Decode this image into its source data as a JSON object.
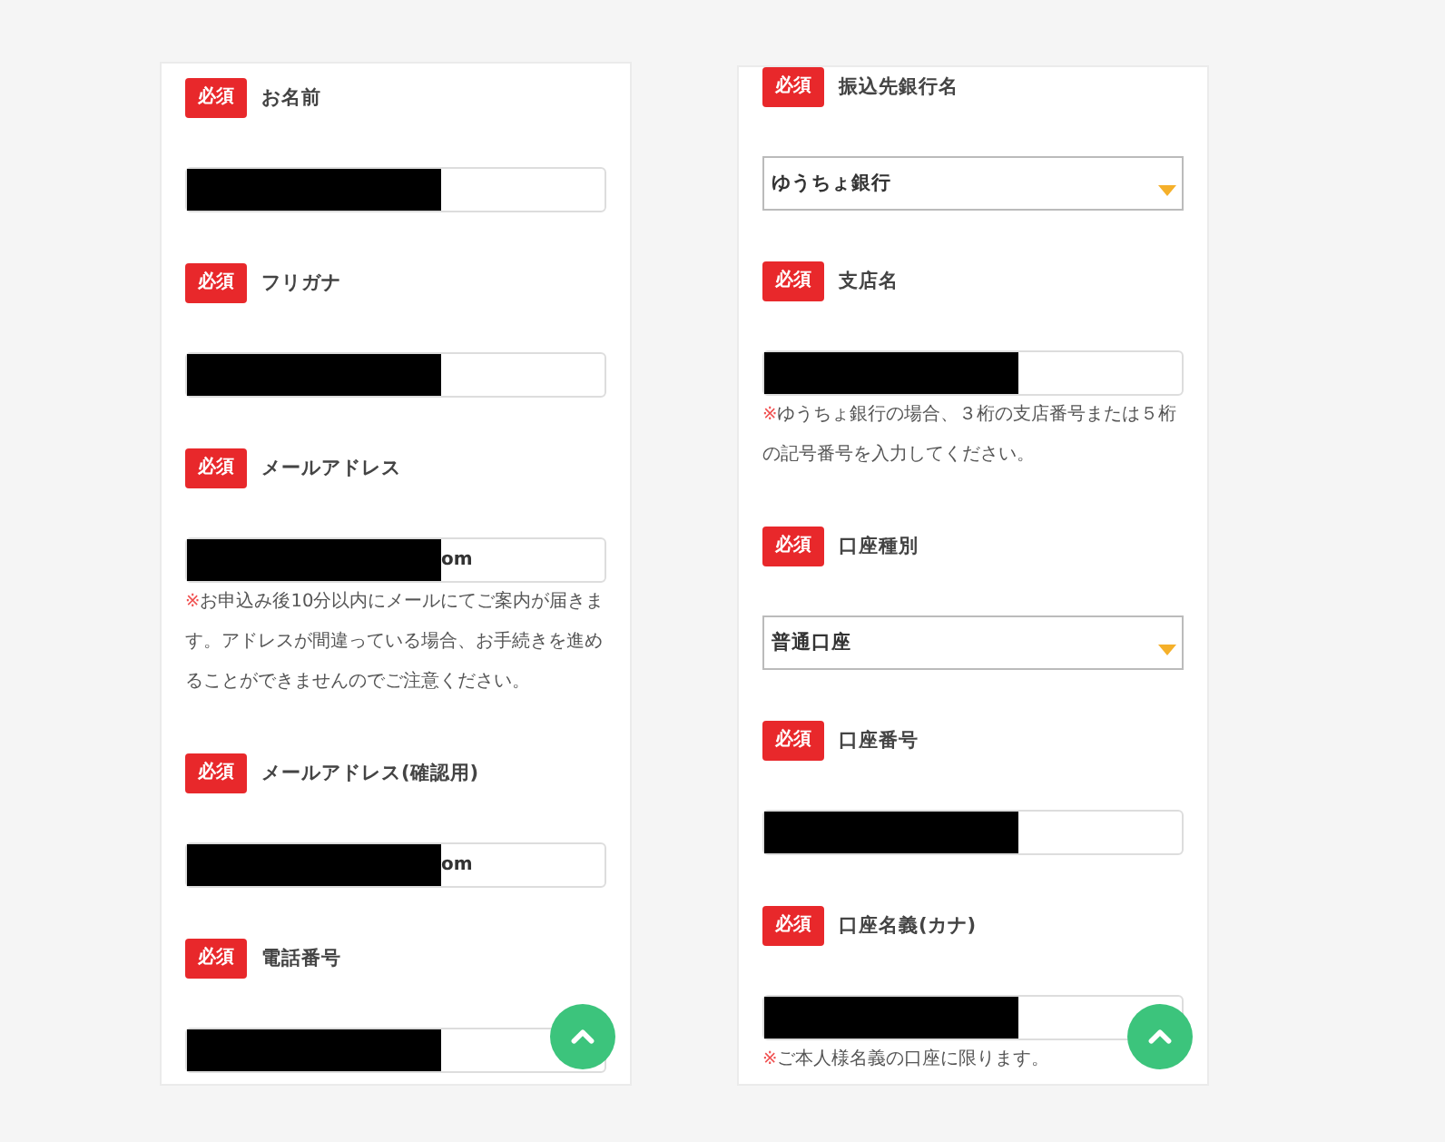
{
  "panels": [
    {
      "fields": [
        {
          "badge": "必須",
          "label": "お名前",
          "kind": "text",
          "redacted": true
        },
        {
          "badge": "必須",
          "label": "フリガナ",
          "kind": "text",
          "redacted": true
        },
        {
          "badge": "必須",
          "label": "メールアドレス",
          "kind": "text",
          "redacted": true,
          "value": "om",
          "note_mark": "※",
          "note": "お申込み後10分以内にメールにてご案内が届きます。アドレスが間違っている場合、お手続きを進めることができませんのでご注意ください。"
        },
        {
          "badge": "必須",
          "label": "メールアドレス(確認用)",
          "kind": "text",
          "redacted": true,
          "value": "om"
        },
        {
          "badge": "必須",
          "label": "電話番号",
          "kind": "text",
          "redacted": true
        }
      ]
    },
    {
      "fields": [
        {
          "badge": "必須",
          "label": "振込先銀行名",
          "kind": "select",
          "value": "ゆうちょ銀行"
        },
        {
          "badge": "必須",
          "label": "支店名",
          "kind": "text",
          "redacted": true,
          "note_mark": "※",
          "note": "ゆうちょ銀行の場合、３桁の支店番号または５桁の記号番号を入力してください。"
        },
        {
          "badge": "必須",
          "label": "口座種別",
          "kind": "select",
          "value": "普通口座"
        },
        {
          "badge": "必須",
          "label": "口座番号",
          "kind": "text",
          "redacted": true
        },
        {
          "badge": "必須",
          "label": "口座名義(カナ)",
          "kind": "text",
          "redacted": true,
          "note_mark": "※",
          "note": "ご本人様名義の口座に限ります。"
        }
      ]
    }
  ]
}
